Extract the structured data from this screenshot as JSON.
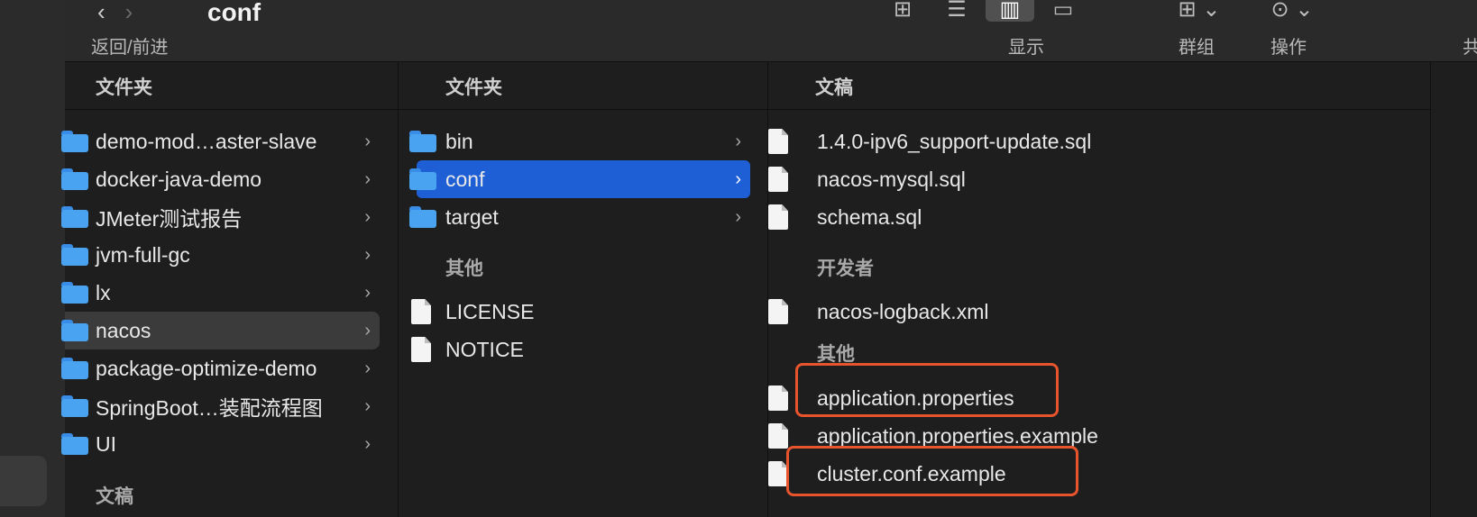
{
  "toolbar": {
    "title": "conf",
    "nav_back": "‹",
    "nav_forward": "›",
    "captions": {
      "nav": "返回/前进",
      "view": "显示",
      "group": "群组",
      "action": "操作",
      "share": "共"
    },
    "icons": {
      "icon_view": "⊞",
      "list_view": "☰",
      "column_view": "▥",
      "gallery_view": "▭",
      "group_menu": "⊞ ⌄",
      "action_menu": "⊙ ⌄"
    }
  },
  "column1": {
    "header": "文件夹",
    "items": [
      {
        "name": "demo-mod…aster-slave"
      },
      {
        "name": "docker-java-demo"
      },
      {
        "name": "JMeter测试报告"
      },
      {
        "name": "jvm-full-gc"
      },
      {
        "name": "lx"
      },
      {
        "name": "nacos"
      },
      {
        "name": "package-optimize-demo"
      },
      {
        "name": "SpringBoot…装配流程图"
      },
      {
        "name": "UI"
      }
    ],
    "footer_group": "文稿",
    "chevron": "›"
  },
  "column2": {
    "header": "文件夹",
    "folders": [
      {
        "name": "bin"
      },
      {
        "name": "conf"
      },
      {
        "name": "target"
      }
    ],
    "other_group": "其他",
    "files": [
      {
        "name": "LICENSE"
      },
      {
        "name": "NOTICE"
      }
    ],
    "chevron": "›"
  },
  "column3": {
    "header": "文稿",
    "docs": [
      {
        "name": "1.4.0-ipv6_support-update.sql"
      },
      {
        "name": "nacos-mysql.sql"
      },
      {
        "name": "schema.sql"
      }
    ],
    "dev_group": "开发者",
    "dev_files": [
      {
        "name": "nacos-logback.xml"
      }
    ],
    "other_group": "其他",
    "other_files": [
      {
        "name": "application.properties"
      },
      {
        "name": "application.properties.example"
      },
      {
        "name": "cluster.conf.example"
      }
    ]
  },
  "colors": {
    "selection_blue": "#1e5fd6",
    "highlight_red": "#e8552c",
    "folder_blue": "#4aa3f0"
  }
}
